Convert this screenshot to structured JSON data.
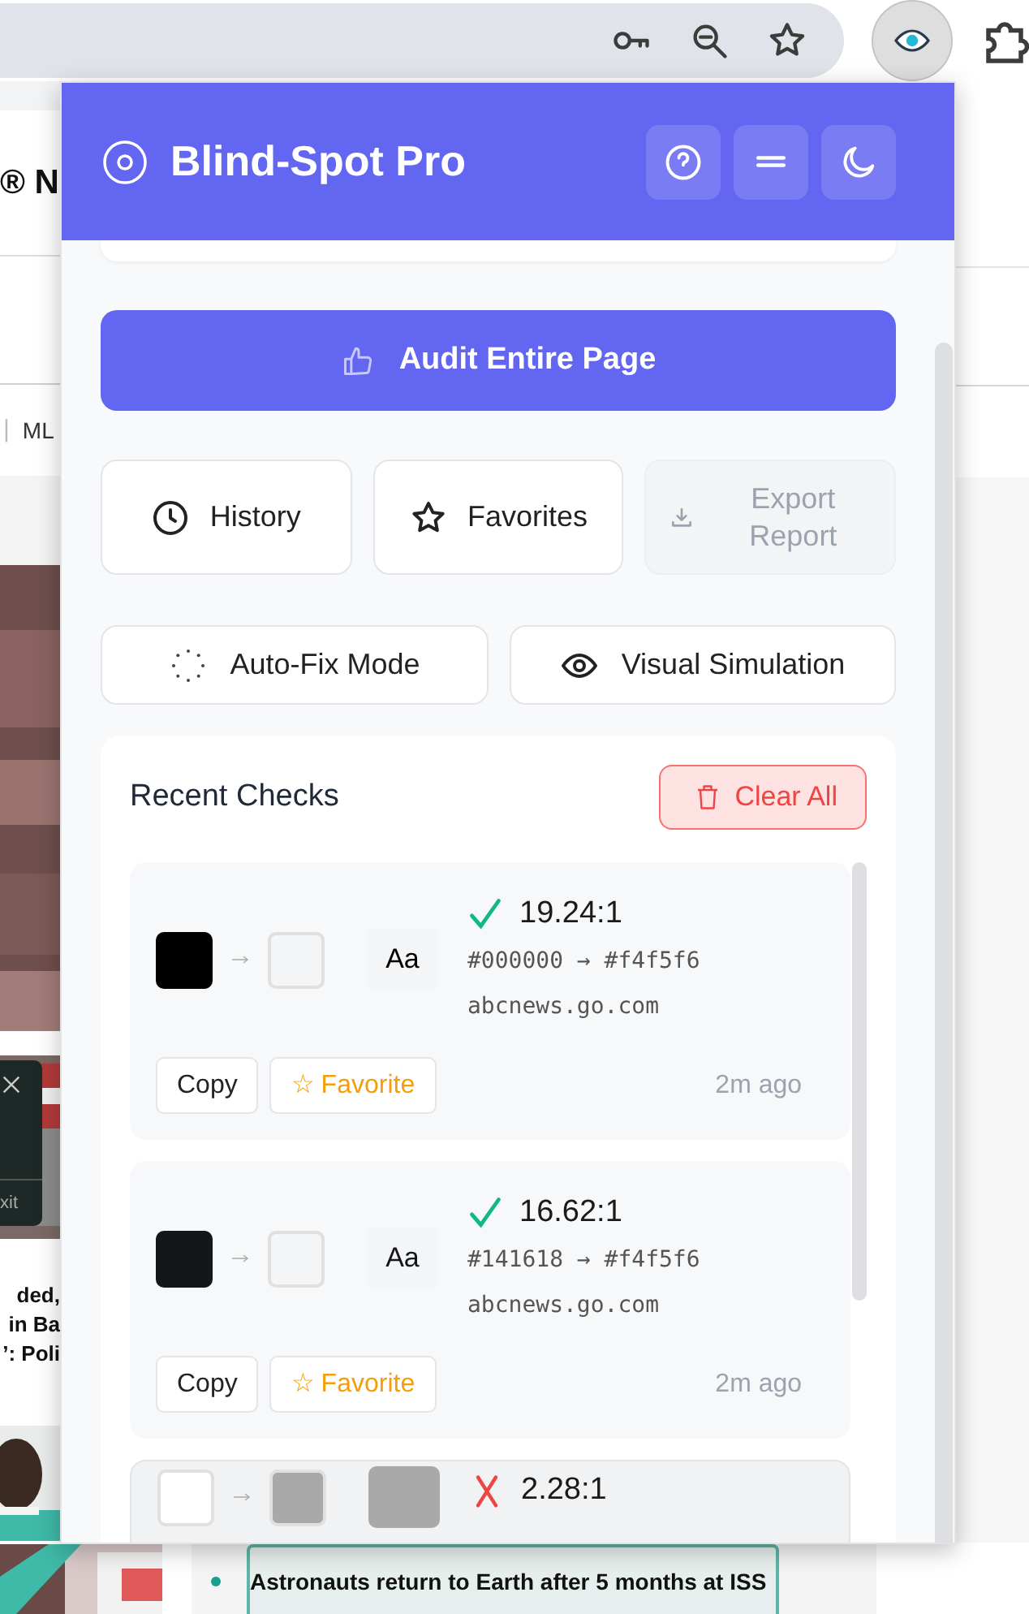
{
  "background_page": {
    "logo_fragment": "® N",
    "nav_divider": "|",
    "nav_fragment": "ML",
    "video_overlay_label": "xit",
    "headline_fragments": [
      "ded,",
      "in Ba",
      "’: Poli"
    ],
    "bullet_headline": "Astronauts return to Earth after 5 months at ISS"
  },
  "popup": {
    "title": "Blind-Spot Pro",
    "audit_button": "Audit Entire Page",
    "actions": [
      {
        "label": "History",
        "disabled": false
      },
      {
        "label": "Favorites",
        "disabled": false
      },
      {
        "label": "Export Report",
        "disabled": true
      }
    ],
    "modes": [
      {
        "label": "Auto-Fix Mode"
      },
      {
        "label": "Visual Simulation"
      }
    ],
    "recent_checks": {
      "title": "Recent Checks",
      "clear_button": "Clear All",
      "items": [
        {
          "swatches": [
            {
              "color": "#000000"
            },
            {
              "color": "#f4f5f6"
            }
          ],
          "sample": "Aa",
          "pass": true,
          "ratio": "19.24:1",
          "hex": "#000000 → #f4f5f6",
          "site": "abcnews.go.com",
          "copy_button": "Copy",
          "favorite_button": "☆ Favorite",
          "time": "2m ago",
          "highlighted": false
        },
        {
          "swatches": [
            {
              "color": "#141618"
            },
            {
              "color": "#f4f5f6"
            }
          ],
          "sample": "Aa",
          "pass": true,
          "ratio": "16.62:1",
          "hex": "#141618 → #f4f5f6",
          "site": "abcnews.go.com",
          "copy_button": "Copy",
          "favorite_button": "☆ Favorite",
          "time": "2m ago",
          "highlighted": false
        },
        {
          "swatches": [
            {
              "color": "#ffffff"
            },
            {
              "color": "#a9a9a9"
            }
          ],
          "pass": false,
          "ratio": "2.28:1",
          "highlighted": true
        }
      ]
    }
  }
}
